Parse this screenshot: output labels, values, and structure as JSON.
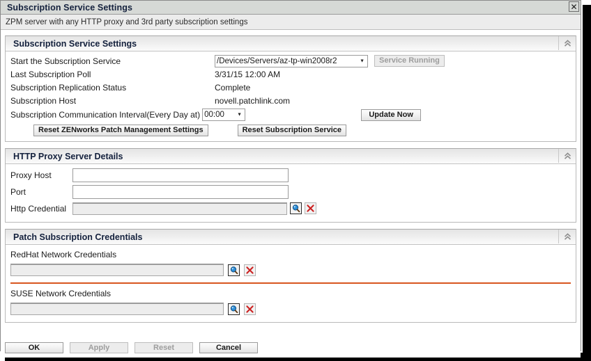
{
  "window": {
    "title": "Subscription Service Settings",
    "subtitle": "ZPM server with any HTTP proxy and 3rd party subscription settings",
    "close_label": "✕"
  },
  "icons": {
    "collapse": "chevron-double-up-icon",
    "search": "magnifier-icon",
    "clear": "red-x-icon",
    "close": "close-icon"
  },
  "colors": {
    "titlebar_bg": "#d6d9d6",
    "subtitle_bg": "#ececec",
    "panel_header_bg": "#eeeeee",
    "heading_text": "#14213d",
    "divider_orange": "#d8551f",
    "readonly_field_bg": "#ededed",
    "icon_red": "#cc2222",
    "icon_blue": "#2f8fd8"
  },
  "panels": {
    "subscription": {
      "title": "Subscription Service Settings",
      "rows": {
        "start_service": {
          "label": "Start the Subscription Service",
          "selected": "/Devices/Servers/az-tp-win2008r2",
          "options": [
            "/Devices/Servers/az-tp-win2008r2"
          ],
          "status_button": "Service Running"
        },
        "last_poll": {
          "label": "Last Subscription Poll",
          "value": "3/31/15 12:00 AM"
        },
        "replication_status": {
          "label": "Subscription Replication Status",
          "value": "Complete"
        },
        "host": {
          "label": "Subscription Host",
          "value": "novell.patchlink.com"
        },
        "interval": {
          "label": "Subscription Communication Interval(Every Day at)",
          "selected": "00:00",
          "options": [
            "00:00"
          ],
          "action_button": "Update Now"
        }
      },
      "buttons": {
        "reset_zenworks": "Reset ZENworks Patch Management Settings",
        "reset_subscription": "Reset Subscription Service"
      }
    },
    "proxy": {
      "title": "HTTP Proxy Server Details",
      "fields": {
        "proxy_host": {
          "label": "Proxy Host",
          "value": "",
          "placeholder": ""
        },
        "port": {
          "label": "Port",
          "value": "",
          "placeholder": ""
        },
        "http_credential": {
          "label": "Http Credential",
          "value": "",
          "placeholder": ""
        }
      }
    },
    "credentials": {
      "title": "Patch Subscription Credentials",
      "groups": [
        {
          "heading": "RedHat Network Credentials",
          "value": "",
          "placeholder": ""
        },
        {
          "heading": "SUSE Network Credentials",
          "value": "",
          "placeholder": ""
        }
      ]
    }
  },
  "footer": {
    "ok": "OK",
    "apply": "Apply",
    "reset": "Reset",
    "cancel": "Cancel"
  }
}
